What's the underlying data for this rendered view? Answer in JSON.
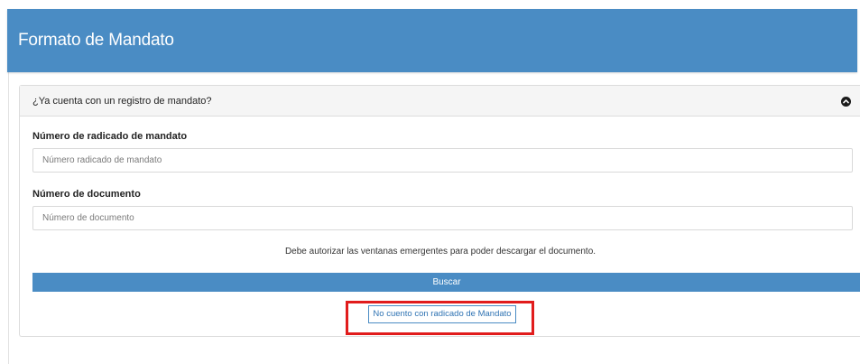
{
  "header": {
    "title": "Formato de Mandato"
  },
  "panel": {
    "heading": "¿Ya cuenta con un registro de mandato?",
    "toggle_icon": "chevron-up-circle-icon",
    "fields": [
      {
        "label": "Número de radicado de mandato",
        "placeholder": "Número radicado de mandato",
        "value": ""
      },
      {
        "label": "Número de documento",
        "placeholder": "Número de documento",
        "value": ""
      }
    ],
    "notice": "Debe autorizar las ventanas emergentes para poder descargar el documento.",
    "search_label": "Buscar",
    "no_radicado_label": "No cuento con radicado de Mandato"
  },
  "colors": {
    "brand_blue": "#4a8cc4",
    "highlight_red": "#e11c1c"
  }
}
